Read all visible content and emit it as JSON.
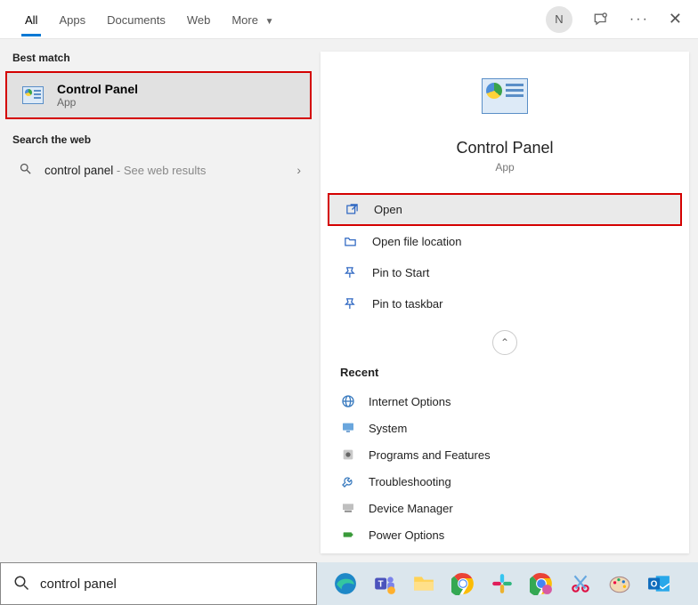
{
  "tabs": {
    "all": "All",
    "apps": "Apps",
    "documents": "Documents",
    "web": "Web",
    "more": "More"
  },
  "user": {
    "initial": "N"
  },
  "left": {
    "best_match_header": "Best match",
    "best_match": {
      "title": "Control Panel",
      "subtitle": "App"
    },
    "search_web_header": "Search the web",
    "web": {
      "query": "control panel",
      "suffix": " - See web results"
    }
  },
  "detail": {
    "title": "Control Panel",
    "subtitle": "App",
    "actions": {
      "open": "Open",
      "open_file_location": "Open file location",
      "pin_start": "Pin to Start",
      "pin_taskbar": "Pin to taskbar"
    },
    "recent_header": "Recent",
    "recent": {
      "internet_options": "Internet Options",
      "system": "System",
      "programs_features": "Programs and Features",
      "troubleshooting": "Troubleshooting",
      "device_manager": "Device Manager",
      "power_options": "Power Options"
    }
  },
  "search": {
    "value": "control panel"
  },
  "taskbar": {
    "edge": "Edge",
    "teams": "Teams",
    "explorer": "File Explorer",
    "chrome": "Chrome",
    "slack": "Slack",
    "chrome2": "Chrome",
    "snip": "Snipping",
    "paint": "Paint",
    "outlook": "Outlook"
  }
}
